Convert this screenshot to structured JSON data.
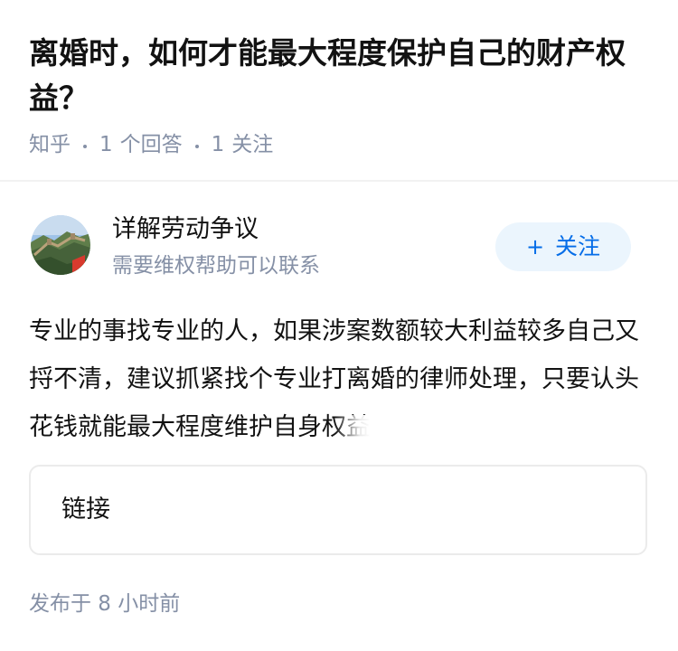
{
  "question": {
    "title": "离婚时，如何才能最大程度保护自己的财产权益？",
    "source": "知乎",
    "answers_count": "1",
    "answers_label": "个回答",
    "followers_count": "1",
    "followers_label": "关注"
  },
  "author": {
    "name": "详解劳动争议",
    "bio": "需要维权帮助可以联系",
    "follow_plus": "+",
    "follow_label": "关注"
  },
  "answer": {
    "text": "专业的事找专业的人，如果涉案数额较大利益较多自己又捋不清，建议抓紧找个专业打离婚的律师处理，只要认头花钱就能最大程度维护自身权益"
  },
  "link_card": {
    "label": "链接"
  },
  "footer": {
    "publish_time": "发布于 8 小时前"
  },
  "colors": {
    "text": "#121212",
    "muted": "#8590a6",
    "accent": "#056de8",
    "accent_bg": "#ebf5fd"
  },
  "icons": {
    "avatar": "great-wall-photo-avatar"
  }
}
